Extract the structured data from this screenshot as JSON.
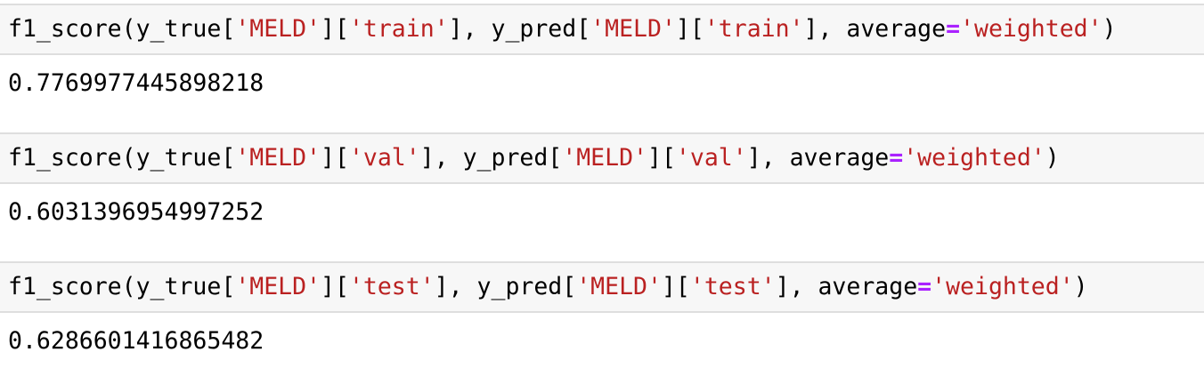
{
  "cells": [
    {
      "input_tokens": [
        {
          "t": "plain",
          "v": "f1_score(y_true["
        },
        {
          "t": "str",
          "v": "'MELD'"
        },
        {
          "t": "plain",
          "v": "]["
        },
        {
          "t": "str",
          "v": "'train'"
        },
        {
          "t": "plain",
          "v": "], y_pred["
        },
        {
          "t": "str",
          "v": "'MELD'"
        },
        {
          "t": "plain",
          "v": "]["
        },
        {
          "t": "str",
          "v": "'train'"
        },
        {
          "t": "plain",
          "v": "], average"
        },
        {
          "t": "op",
          "v": "="
        },
        {
          "t": "str",
          "v": "'weighted'"
        },
        {
          "t": "plain",
          "v": ")"
        }
      ],
      "output": "0.7769977445898218"
    },
    {
      "input_tokens": [
        {
          "t": "plain",
          "v": "f1_score(y_true["
        },
        {
          "t": "str",
          "v": "'MELD'"
        },
        {
          "t": "plain",
          "v": "]["
        },
        {
          "t": "str",
          "v": "'val'"
        },
        {
          "t": "plain",
          "v": "], y_pred["
        },
        {
          "t": "str",
          "v": "'MELD'"
        },
        {
          "t": "plain",
          "v": "]["
        },
        {
          "t": "str",
          "v": "'val'"
        },
        {
          "t": "plain",
          "v": "], average"
        },
        {
          "t": "op",
          "v": "="
        },
        {
          "t": "str",
          "v": "'weighted'"
        },
        {
          "t": "plain",
          "v": ")"
        }
      ],
      "output": "0.6031396954997252"
    },
    {
      "input_tokens": [
        {
          "t": "plain",
          "v": "f1_score(y_true["
        },
        {
          "t": "str",
          "v": "'MELD'"
        },
        {
          "t": "plain",
          "v": "]["
        },
        {
          "t": "str",
          "v": "'test'"
        },
        {
          "t": "plain",
          "v": "], y_pred["
        },
        {
          "t": "str",
          "v": "'MELD'"
        },
        {
          "t": "plain",
          "v": "]["
        },
        {
          "t": "str",
          "v": "'test'"
        },
        {
          "t": "plain",
          "v": "], average"
        },
        {
          "t": "op",
          "v": "="
        },
        {
          "t": "str",
          "v": "'weighted'"
        },
        {
          "t": "plain",
          "v": ")"
        }
      ],
      "output": "0.6286601416865482"
    }
  ],
  "colors": {
    "string": "#ba2121",
    "operator": "#aa22ff",
    "input_background": "#f7f7f7",
    "input_border": "#dedede"
  }
}
